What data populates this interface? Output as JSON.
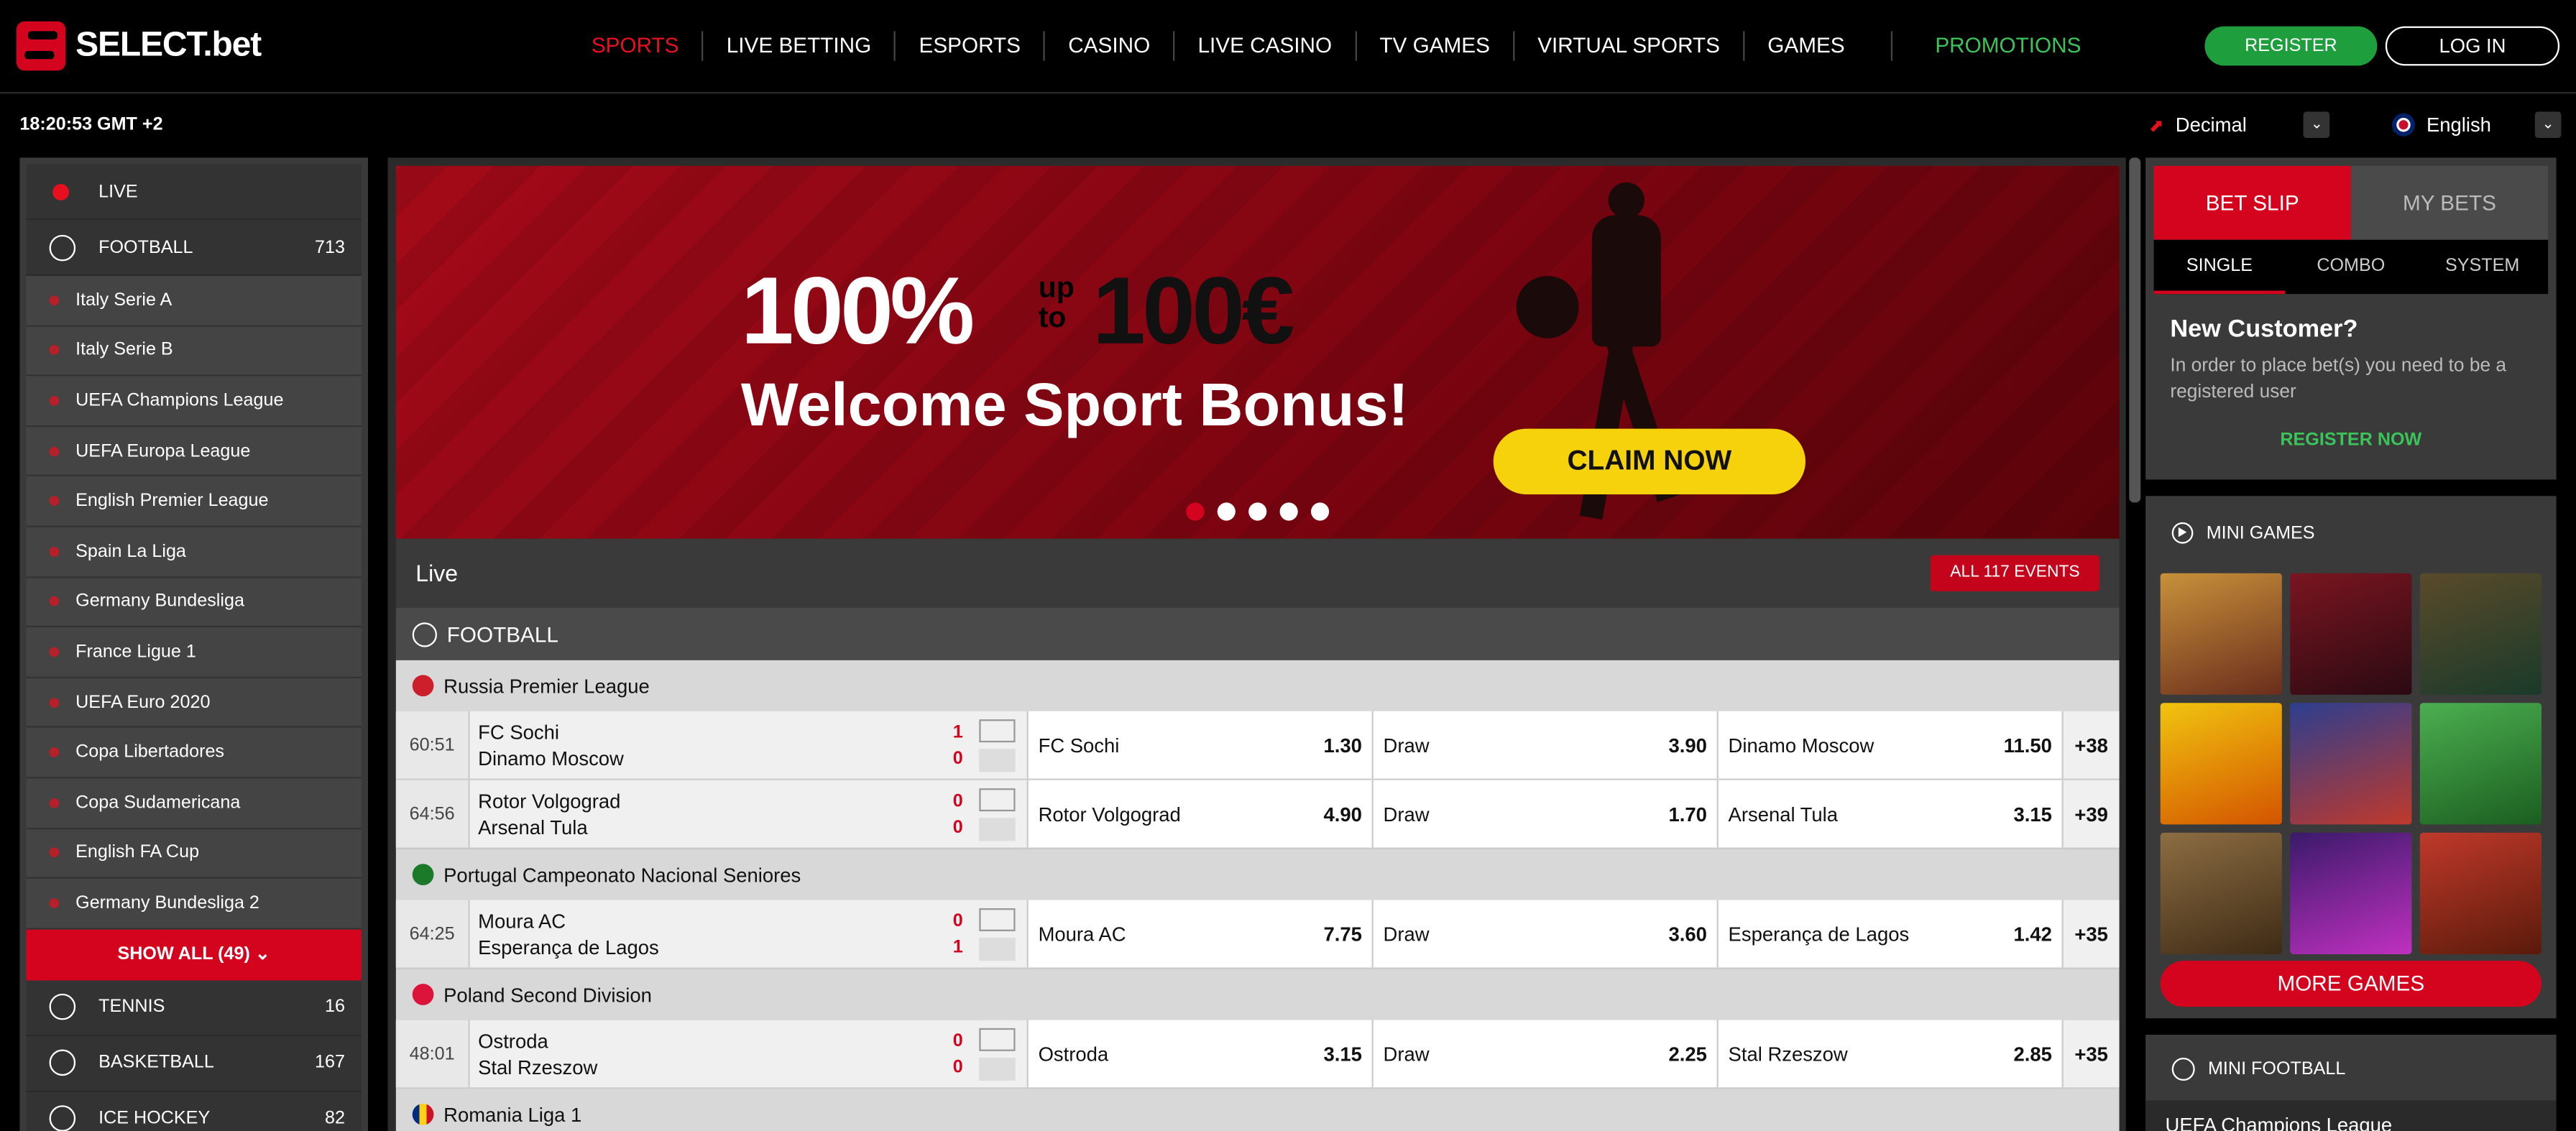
{
  "header": {
    "logo_text": "SELECT.bet",
    "nav": [
      "SPORTS",
      "LIVE BETTING",
      "ESPORTS",
      "CASINO",
      "LIVE CASINO",
      "TV GAMES",
      "VIRTUAL SPORTS",
      "GAMES"
    ],
    "promo": "PROMOTIONS",
    "register": "REGISTER",
    "login": "LOG IN"
  },
  "subbar": {
    "clock": "18:20:53 GMT +2",
    "odds_format": "Decimal",
    "language": "English"
  },
  "sidebar": {
    "live": "LIVE",
    "football": {
      "label": "FOOTBALL",
      "count": "713"
    },
    "leagues": [
      "Italy Serie A",
      "Italy Serie B",
      "UEFA Champions League",
      "UEFA Europa League",
      "English Premier League",
      "Spain La Liga",
      "Germany Bundesliga",
      "France Ligue 1",
      "UEFA Euro 2020",
      "Copa Libertadores",
      "Copa Sudamericana",
      "English FA Cup",
      "Germany Bundesliga 2"
    ],
    "show_all": "SHOW ALL (49)",
    "sports": [
      {
        "label": "TENNIS",
        "count": "16"
      },
      {
        "label": "BASKETBALL",
        "count": "167"
      },
      {
        "label": "ICE HOCKEY",
        "count": "82"
      }
    ]
  },
  "banner": {
    "big": "100%",
    "up": "up",
    "to": "to",
    "amount": "100€",
    "welcome": "Welcome Sport Bonus!",
    "claim": "CLAIM NOW"
  },
  "live": {
    "title": "Live",
    "all_events": "ALL 117 EVENTS",
    "sport": "FOOTBALL",
    "leagues": [
      {
        "name": "Russia Premier League",
        "flag": "#cc1e2b",
        "matches": [
          {
            "time": "60:51",
            "home": "FC Sochi",
            "away": "Dinamo Moscow",
            "hs": "1",
            "as": "0",
            "o1n": "FC Sochi",
            "o1": "1.30",
            "oxn": "Draw",
            "ox": "3.90",
            "o2n": "Dinamo Moscow",
            "o2": "11.50",
            "more": "+38"
          },
          {
            "time": "64:56",
            "home": "Rotor Volgograd",
            "away": "Arsenal Tula",
            "hs": "0",
            "as": "0",
            "o1n": "Rotor Volgograd",
            "o1": "4.90",
            "oxn": "Draw",
            "ox": "1.70",
            "o2n": "Arsenal Tula",
            "o2": "3.15",
            "more": "+39"
          }
        ]
      },
      {
        "name": "Portugal Campeonato Nacional Seniores",
        "flag": "#1a7a2a",
        "matches": [
          {
            "time": "64:25",
            "home": "Moura AC",
            "away": "Esperança de Lagos",
            "hs": "0",
            "as": "1",
            "o1n": "Moura AC",
            "o1": "7.75",
            "oxn": "Draw",
            "ox": "3.60",
            "o2n": "Esperança de Lagos",
            "o2": "1.42",
            "more": "+35"
          }
        ]
      },
      {
        "name": "Poland Second Division",
        "flag": "#dc143c",
        "matches": [
          {
            "time": "48:01",
            "home": "Ostroda",
            "away": "Stal Rzeszow",
            "hs": "0",
            "as": "0",
            "o1n": "Ostroda",
            "o1": "3.15",
            "oxn": "Draw",
            "ox": "2.25",
            "o2n": "Stal Rzeszow",
            "o2": "2.85",
            "more": "+35"
          }
        ]
      }
    ],
    "next_league": "Romania Liga 1"
  },
  "betslip": {
    "tab_slip": "BET SLIP",
    "tab_mybets": "MY BETS",
    "sub": [
      "SINGLE",
      "COMBO",
      "SYSTEM"
    ],
    "nc_title": "New Customer?",
    "nc_text": "In order to place bet(s) you need to be a registered user",
    "nc_register": "REGISTER NOW"
  },
  "minigames": {
    "title": "MINI GAMES",
    "more": "MORE GAMES"
  },
  "minifootball": {
    "title": "MINI FOOTBALL",
    "league": "UEFA Champions League"
  }
}
